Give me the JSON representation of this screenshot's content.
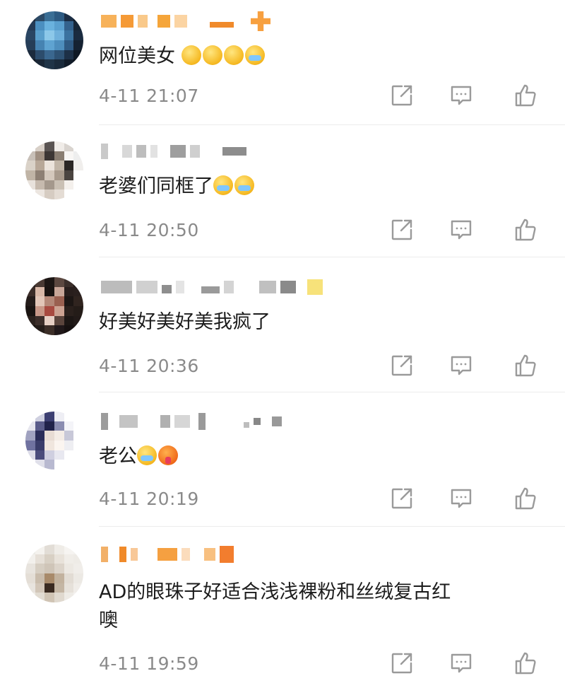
{
  "comments": [
    {
      "text": "网位美女",
      "time": "4-11 21:07"
    },
    {
      "text": "老婆们同框了",
      "time": "4-11 20:50"
    },
    {
      "text": "好美好美好美我疯了",
      "time": "4-11 20:36"
    },
    {
      "text": "老公",
      "time": "4-11 20:19"
    },
    {
      "text": "AD的眼珠子好适合浅浅裸粉和丝绒复古红\n噢",
      "time": "4-11 19:59"
    }
  ],
  "icons": {
    "repost": "repost-icon",
    "comment": "comment-icon",
    "like": "like-icon"
  },
  "colors": {
    "accent": "#f5a53a",
    "time": "#8a8a8a",
    "icon": "#9a9a9a"
  }
}
